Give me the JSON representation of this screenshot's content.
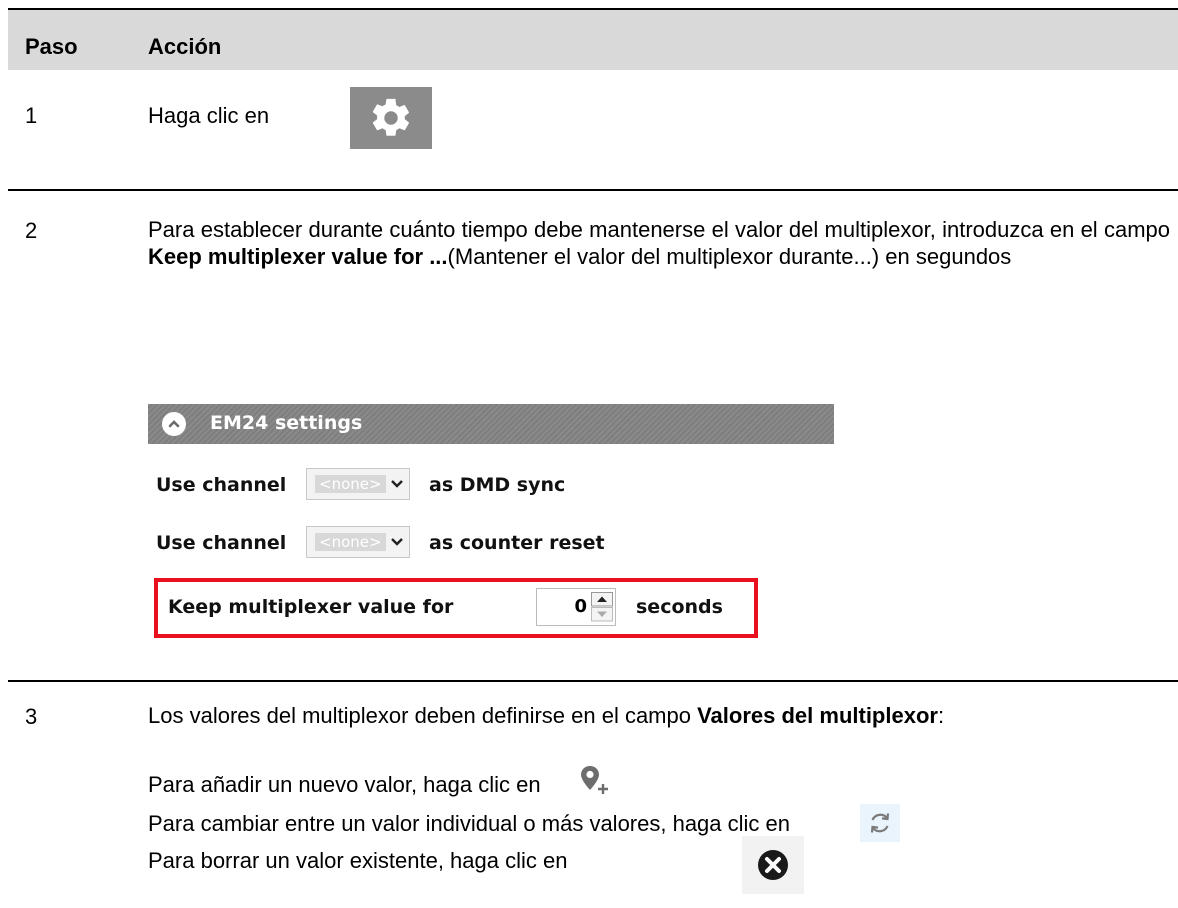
{
  "header": {
    "col_step": "Paso",
    "col_action": "Acción"
  },
  "step1": {
    "number": "1",
    "text": "Haga clic en",
    "icon": "gear-icon"
  },
  "step2": {
    "number": "2",
    "text_before": "Para establecer durante cuánto tiempo debe mantenerse el valor del multiplexor, introduzca en el campo ",
    "field_name": "Keep multiplexer value for ...",
    "text_after": "(Mantener el valor del multiplexor durante...) en segundos",
    "panel": {
      "title": "EM24 settings",
      "row1": {
        "prefix": "Use channel",
        "value": "<none>",
        "suffix": "as DMD sync"
      },
      "row2": {
        "prefix": "Use channel",
        "value": "<none>",
        "suffix": "as counter reset"
      },
      "row3": {
        "prefix": "Keep multiplexer value for",
        "value": "0",
        "suffix": "seconds"
      },
      "highlight_color": "#e8101d"
    }
  },
  "step3": {
    "number": "3",
    "text_before": "Los valores del multiplexor deben definirse en el campo ",
    "field_name": "Valores del multiplexor",
    "text_after": ":",
    "line_add": "Para añadir un nuevo valor, haga clic en",
    "line_switch": "Para cambiar entre un valor individual o más valores, haga clic en",
    "line_delete": "Para borrar un valor existente, haga clic en",
    "icons": [
      "add-location-icon",
      "refresh-icon",
      "delete-circle-icon"
    ]
  }
}
